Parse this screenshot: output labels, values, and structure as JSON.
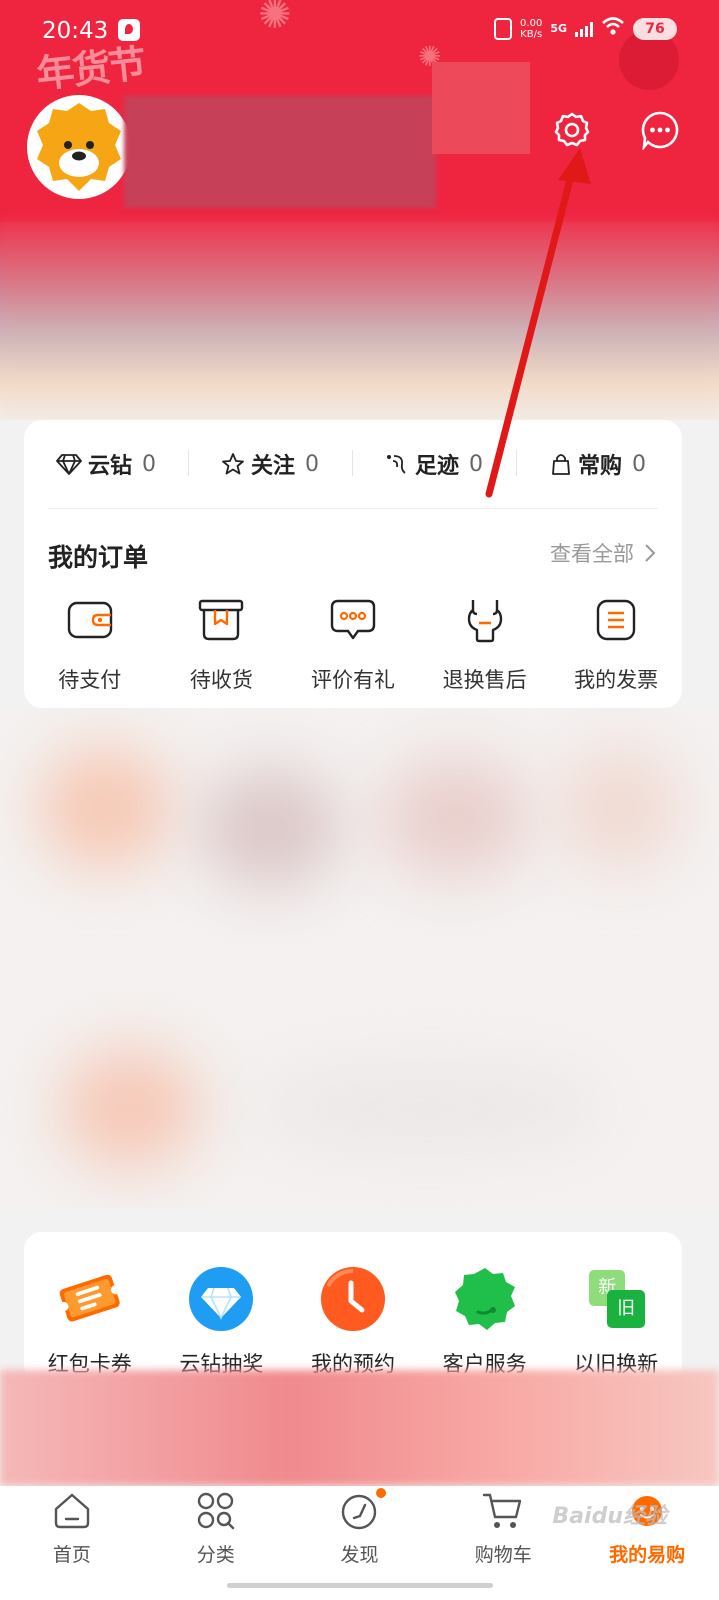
{
  "status_bar": {
    "time": "20:43",
    "net_speed_value": "0.00",
    "net_speed_unit": "KB/s",
    "network": "5G",
    "battery": "76"
  },
  "header": {
    "festival_text": "年货节",
    "icons": [
      "settings-gear-icon",
      "message-more-icon"
    ]
  },
  "stats": [
    {
      "icon": "diamond-icon",
      "label": "云钻",
      "value": "0"
    },
    {
      "icon": "star-icon",
      "label": "关注",
      "value": "0"
    },
    {
      "icon": "footprint-icon",
      "label": "足迹",
      "value": "0"
    },
    {
      "icon": "bag-icon",
      "label": "常购",
      "value": "0"
    }
  ],
  "orders": {
    "title": "我的订单",
    "view_all": "查看全部",
    "items": [
      {
        "icon": "wallet-icon",
        "label": "待支付"
      },
      {
        "icon": "box-icon",
        "label": "待收货"
      },
      {
        "icon": "comment-icon",
        "label": "评价有礼"
      },
      {
        "icon": "wrench-icon",
        "label": "退换售后"
      },
      {
        "icon": "invoice-icon",
        "label": "我的发票"
      }
    ]
  },
  "services": [
    {
      "icon": "coupon-icon",
      "label": "红包卡券"
    },
    {
      "icon": "diamond-lottery-icon",
      "label": "云钻抽奖"
    },
    {
      "icon": "clock-icon",
      "label": "我的预约"
    },
    {
      "icon": "customer-service-icon",
      "label": "客户服务"
    },
    {
      "icon": "trade-in-icon",
      "label": "以旧换新",
      "badge_new": "新",
      "badge_old": "旧"
    }
  ],
  "tabbar": [
    {
      "icon": "home-icon",
      "label": "首页",
      "active": false
    },
    {
      "icon": "category-icon",
      "label": "分类",
      "active": false
    },
    {
      "icon": "discover-icon",
      "label": "发现",
      "active": false
    },
    {
      "icon": "cart-icon",
      "label": "购物车",
      "active": false
    },
    {
      "icon": "my-suning-icon",
      "label": "我的易购",
      "active": true
    }
  ],
  "watermark": "Baidu经验",
  "colors": {
    "brand_red": "#ef2540",
    "accent_orange": "#ff6a00",
    "annotation_red": "#e01818"
  }
}
